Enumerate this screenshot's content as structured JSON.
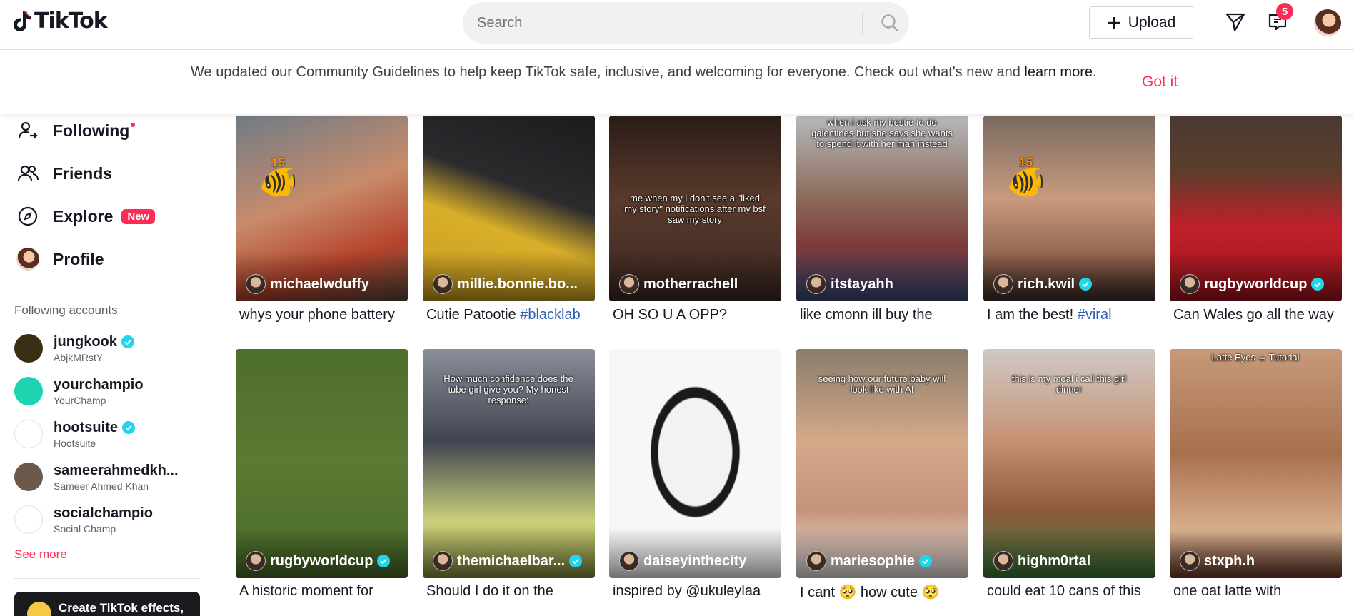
{
  "header": {
    "logo_text": "TikTok",
    "search_placeholder": "Search",
    "upload_label": "Upload",
    "inbox_count": "5",
    "icons": [
      "tiktok-logo-icon",
      "search-icon",
      "plus-icon",
      "send-icon",
      "inbox-icon"
    ]
  },
  "banner": {
    "text": "We updated our Community Guidelines to help keep TikTok safe, inclusive, and welcoming for everyone. Check out what's new and ",
    "link": "learn more",
    "period": ".",
    "dismiss": "Got it"
  },
  "sidebar": {
    "nav": [
      {
        "label": "Following",
        "icon": "following-icon"
      },
      {
        "label": "Friends",
        "icon": "friends-icon"
      },
      {
        "label": "Explore",
        "icon": "compass-icon",
        "badge": "New"
      },
      {
        "label": "Profile",
        "icon": "avatar"
      }
    ],
    "section_title": "Following accounts",
    "accounts": [
      {
        "name": "jungkook",
        "sub": "AbjkMRstY",
        "verified": true,
        "color": "#3a2e14"
      },
      {
        "name": "yourchampio",
        "sub": "YourChamp",
        "verified": false,
        "color": "#1fd3b0"
      },
      {
        "name": "hootsuite",
        "sub": "Hootsuite",
        "verified": true,
        "color": "#ffffff"
      },
      {
        "name": "sameerahmedkh...",
        "sub": "Sameer Ahmed Khan",
        "verified": false,
        "color": "#6b5a4c"
      },
      {
        "name": "socialchampio",
        "sub": "Social Champ",
        "verified": false,
        "color": "#ffffff"
      }
    ],
    "see_more": "See more",
    "effects_label": "Create TikTok effects,"
  },
  "videos": [
    {
      "author": "michaelwduffy",
      "verified": false,
      "caption": "whys your phone battery",
      "hashtag": "",
      "overlay": "",
      "fish": "15",
      "bg": "linear-gradient(160deg,#6f7c86 0%,#c88b6a 45%,#b5432c 75%,#5b4a3c 100%)"
    },
    {
      "author": "millie.bonnie.bo...",
      "verified": false,
      "caption": "Cutie Patootie ",
      "hashtag": "#blacklab",
      "overlay": "",
      "fish": "",
      "bg": "linear-gradient(200deg,#1c1c1f 0%,#2b2b2e 40%,#d8ae2a 60%,#c89b1d 100%)"
    },
    {
      "author": "motherrachell",
      "verified": false,
      "caption": "OH SO U A OPP?",
      "hashtag": "",
      "overlay": "me when my i don't see a \"liked my story\" notifications after my bsf saw my story",
      "fish": "",
      "bg": "linear-gradient(180deg,#2a1c17 0%,#5a3a2c 45%,#3a2822 100%)"
    },
    {
      "author": "itstayahh",
      "verified": false,
      "caption": "like cmonn ill buy the",
      "hashtag": "",
      "overlay": "when i ask my bestie to do galentines but she says she wants to spend it with her man instead",
      "fish": "",
      "bg": "linear-gradient(180deg,#b7b8bc 0%,#8b6a5a 45%,#7d3a3a 70%,#3a4a7a 100%)"
    },
    {
      "author": "rich.kwil",
      "verified": true,
      "caption": "I am the best! ",
      "hashtag": "#viral",
      "overlay": "",
      "fish": "15",
      "bg": "linear-gradient(180deg,#7a6a60 0%,#c99a7f 45%,#8a5d48 80%,#3a2c28 100%)"
    },
    {
      "author": "rugbyworldcup",
      "verified": true,
      "caption": "Can Wales go all the way",
      "hashtag": "",
      "overlay": "",
      "fish": "",
      "bg": "linear-gradient(180deg,#4a3a32 0%,#5c3d2c 30%,#c0202a 60%,#a0141e 100%)"
    },
    {
      "author": "rugbyworldcup",
      "verified": true,
      "caption": "A historic moment for",
      "hashtag": "",
      "overlay": "",
      "fish": "",
      "bg": "linear-gradient(180deg,#4e6e2c 0%,#5b7a33 50%,#476a28 100%)"
    },
    {
      "author": "themichaelbar...",
      "verified": true,
      "caption": "Should I do it on the",
      "hashtag": "",
      "overlay": "How much confidence does the tube girl give you? My honest response:",
      "fish": "",
      "bg": "linear-gradient(180deg,#8a8e98 0%,#3f4450 40%,#c9cf7a 75%,#8a9040 100%)"
    },
    {
      "author": "daiseyinthecity",
      "verified": false,
      "caption": "inspired by @ukuleylaa",
      "hashtag": "",
      "overlay": "",
      "fish": "",
      "bg": "radial-gradient(ellipse at 50% 45%,#f2f2f2 0 30%,#1a1a1a 31% 36%,#f7f7f7 37%)"
    },
    {
      "author": "mariesophie",
      "verified": true,
      "caption": "I cant 🥺 how cute 🥺",
      "hashtag": "",
      "overlay": "seeing how our future baby will look like with AI",
      "fish": "",
      "bg": "linear-gradient(180deg,#8a7d6c 0%,#d6a98a 40%,#c5927a 70%,#ece8e4 100%)"
    },
    {
      "author": "highm0rtal",
      "verified": false,
      "caption": "could eat 10 cans of this",
      "hashtag": "",
      "overlay": "this is my meal i call this girl dinner",
      "fish": "",
      "bg": "linear-gradient(180deg,#cfc9c4 0%,#c69274 40%,#8e5a3e 70%,#3d7a3a 100%)"
    },
    {
      "author": "stxph.h",
      "verified": false,
      "caption": "one oat latte with",
      "hashtag": "",
      "overlay": "Latte Eyes ☕ Tutorial",
      "fish": "",
      "bg": "linear-gradient(180deg,#c79a7a 0%,#a8704e 45%,#d9b090 80%,#6a3c2a 100%)"
    }
  ]
}
